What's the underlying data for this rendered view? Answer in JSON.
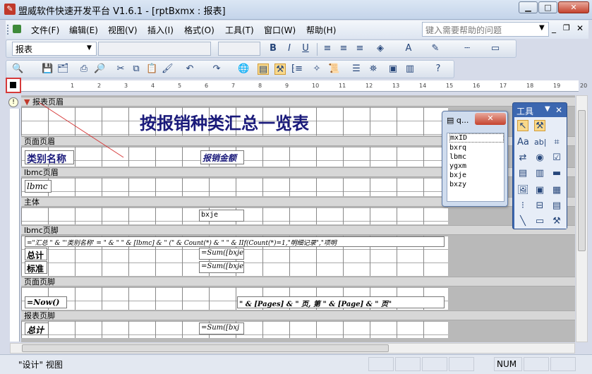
{
  "window": {
    "title": "盟威软件快速开发平台 V1.6.1 - [rptBxmx : 报表]"
  },
  "menu": {
    "items": [
      "文件(F)",
      "编辑(E)",
      "视图(V)",
      "插入(I)",
      "格式(O)",
      "工具(T)",
      "窗口(W)",
      "帮助(H)"
    ],
    "help_placeholder": "键入需要帮助的问题"
  },
  "toolbar": {
    "object_combo": "报表"
  },
  "ruler": {
    "ticks": [
      "1",
      "2",
      "3",
      "4",
      "5",
      "6",
      "7",
      "8",
      "9",
      "10",
      "11",
      "12",
      "13",
      "14",
      "15",
      "16",
      "17",
      "18",
      "19",
      "20"
    ]
  },
  "report": {
    "title": "按报销种类汇总一览表",
    "sections": {
      "report_header": "报表页眉",
      "page_header": "页面页眉",
      "group_header": "lbmc页眉",
      "detail": "主体",
      "group_footer": "lbmc页脚",
      "page_footer": "页面页脚",
      "report_footer": "报表页脚"
    },
    "labels": {
      "category": "类别名称",
      "amount": "报销金额",
      "total": "总计",
      "standard": "标准",
      "report_total": "总计"
    },
    "fields": {
      "lbmc": "lbmc",
      "bxje": "bxje",
      "summary_expr": "=\"汇总 \" & \"'类别名称' = \" & \" \" & [lbmc] & \" (\" & Count(*) & \" \" & IIf(Count(*)=1,\"明细记录\",\"项明",
      "sum_bxje": "=Sum([bxje",
      "sum_bxje2": "=Sum([bxje",
      "now_expr": "=Now()",
      "page_expr": "\" & [Pages] & \" 页, 第 \" & [Page] & \" 页\"",
      "sum_bxj": "=Sum([bxj"
    }
  },
  "field_list": {
    "title": "q...",
    "items": [
      "mxID",
      "bxrq",
      "lbmc",
      "ygxm",
      "bxje",
      "bxzy"
    ]
  },
  "toolbox": {
    "title": "工具"
  },
  "status": {
    "mode": "\"设计\" 视图",
    "num": "NUM"
  }
}
